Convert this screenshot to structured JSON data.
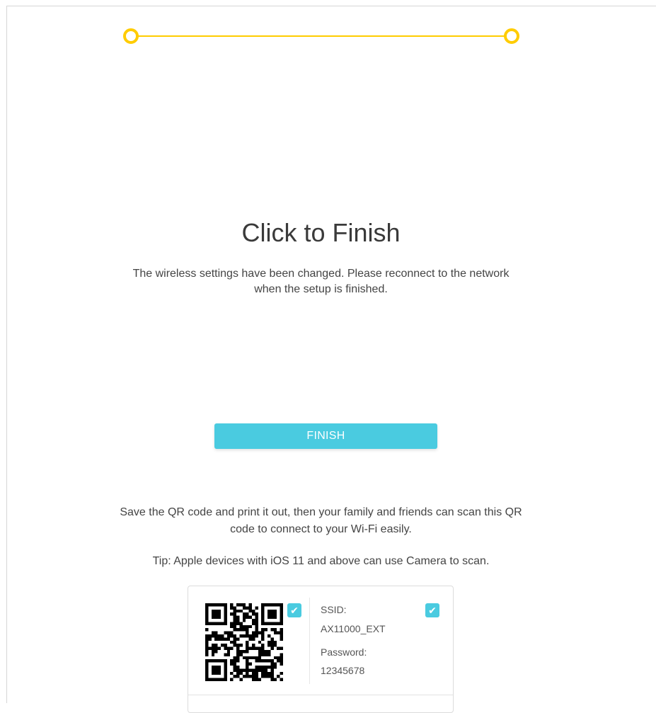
{
  "progress": {
    "steps_completed": 2,
    "steps_total": 2,
    "accent_color": "#ffcc00"
  },
  "page": {
    "title": "Click to Finish",
    "description_line1": "The wireless settings have been changed. Please reconnect to the network",
    "description_line2": "when the setup is finished."
  },
  "finish_button": {
    "label": "FINISH",
    "color": "#4acbe0"
  },
  "qr_section": {
    "info_line1": "Save the QR code and print it out, then your family and friends can scan this QR",
    "info_line2": "code to connect to your Wi-Fi easily.",
    "tip": "Tip: Apple devices with iOS 11 and above can use Camera to scan."
  },
  "qr_card": {
    "qr_checked": true,
    "info_checked": true,
    "ssid_label": "SSID:",
    "ssid_value": "AX11000_EXT",
    "password_label": "Password:",
    "password_value": "12345678",
    "check_glyph": "✔"
  }
}
